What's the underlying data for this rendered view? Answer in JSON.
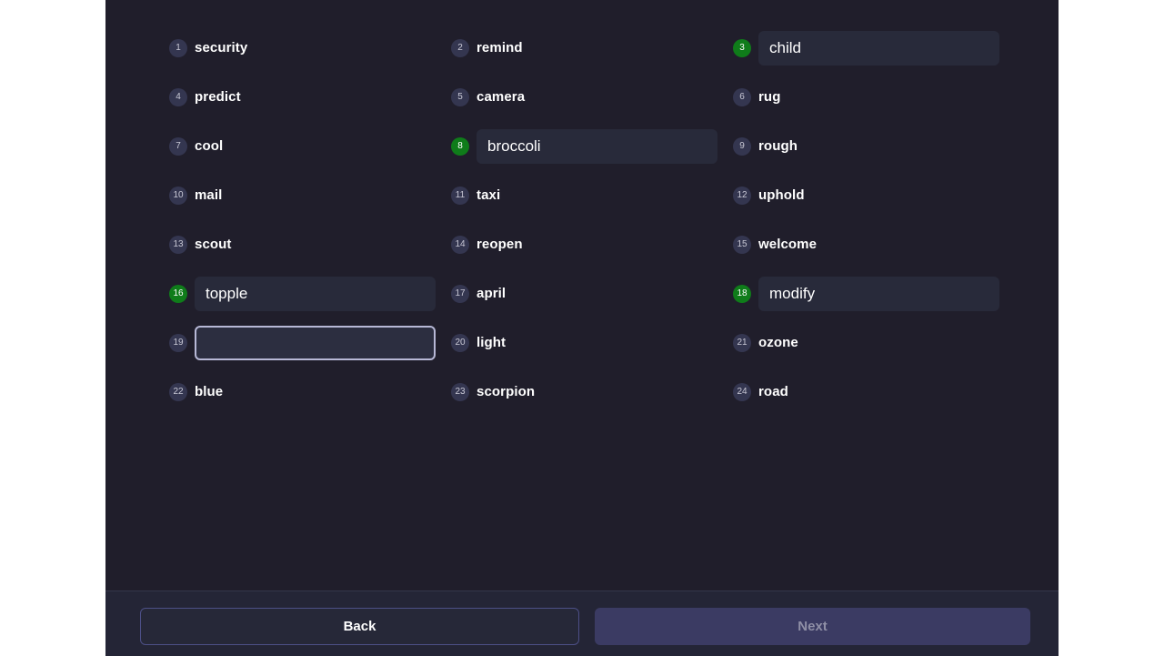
{
  "words": [
    {
      "n": "1",
      "word": "security",
      "kind": "text"
    },
    {
      "n": "2",
      "word": "remind",
      "kind": "text"
    },
    {
      "n": "3",
      "word": "child",
      "kind": "filled"
    },
    {
      "n": "4",
      "word": "predict",
      "kind": "text"
    },
    {
      "n": "5",
      "word": "camera",
      "kind": "text"
    },
    {
      "n": "6",
      "word": "rug",
      "kind": "text"
    },
    {
      "n": "7",
      "word": "cool",
      "kind": "text"
    },
    {
      "n": "8",
      "word": "broccoli",
      "kind": "filled"
    },
    {
      "n": "9",
      "word": "rough",
      "kind": "text"
    },
    {
      "n": "10",
      "word": "mail",
      "kind": "text"
    },
    {
      "n": "11",
      "word": "taxi",
      "kind": "text"
    },
    {
      "n": "12",
      "word": "uphold",
      "kind": "text"
    },
    {
      "n": "13",
      "word": "scout",
      "kind": "text"
    },
    {
      "n": "14",
      "word": "reopen",
      "kind": "text"
    },
    {
      "n": "15",
      "word": "welcome",
      "kind": "text"
    },
    {
      "n": "16",
      "word": "topple",
      "kind": "filled"
    },
    {
      "n": "17",
      "word": "april",
      "kind": "text"
    },
    {
      "n": "18",
      "word": "modify",
      "kind": "filled"
    },
    {
      "n": "19",
      "word": "",
      "kind": "active"
    },
    {
      "n": "20",
      "word": "light",
      "kind": "text"
    },
    {
      "n": "21",
      "word": "ozone",
      "kind": "text"
    },
    {
      "n": "22",
      "word": "blue",
      "kind": "text"
    },
    {
      "n": "23",
      "word": "scorpion",
      "kind": "text"
    },
    {
      "n": "24",
      "word": "road",
      "kind": "text"
    }
  ],
  "footer": {
    "back_label": "Back",
    "next_label": "Next"
  },
  "colors": {
    "panel": "#201e2b",
    "badge": "#343650",
    "badge_confirmed": "#0f7c1a",
    "input": "#282a3a",
    "next_disabled": "#3b3b63"
  }
}
